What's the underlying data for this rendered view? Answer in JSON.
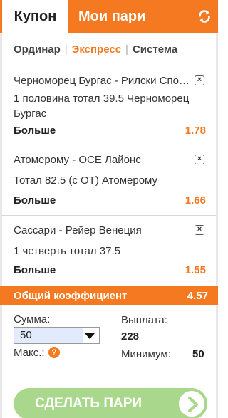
{
  "header": {
    "tab_coupon": "Купон",
    "tab_my_bets": "Мои пари",
    "refresh_icon": "refresh-icon"
  },
  "modes": {
    "single": "Ординар",
    "express": "Экспресс",
    "system": "Система",
    "active": "express"
  },
  "bets": [
    {
      "match": "Черноморец Бургас - Рилски Спортист",
      "market": "1 половина тотал 39.5 Черноморец Бургас",
      "selection": "Больше",
      "odd": "1.78"
    },
    {
      "match": "Атомерому - ОСЕ Лайонс",
      "market": "Тотал 82.5 (с ОТ) Атомерому",
      "selection": "Больше",
      "odd": "1.66"
    },
    {
      "match": "Сассари - Рейер Венеция",
      "market": "1 четверть тотал 37.5",
      "selection": "Больше",
      "odd": "1.55"
    }
  ],
  "total": {
    "label": "Общий коэффициент",
    "value": "4.57"
  },
  "stake": {
    "label": "Сумма:",
    "value": "50",
    "max_label": "Макс.:"
  },
  "payout": {
    "label": "Выплата:",
    "value": "228",
    "min_label": "Минимум:",
    "min_value": "50"
  },
  "place_bet": {
    "label": "СДЕЛАТЬ ПАРИ"
  },
  "colors": {
    "accent": "#f47920",
    "button_green": "#a9d88d"
  }
}
